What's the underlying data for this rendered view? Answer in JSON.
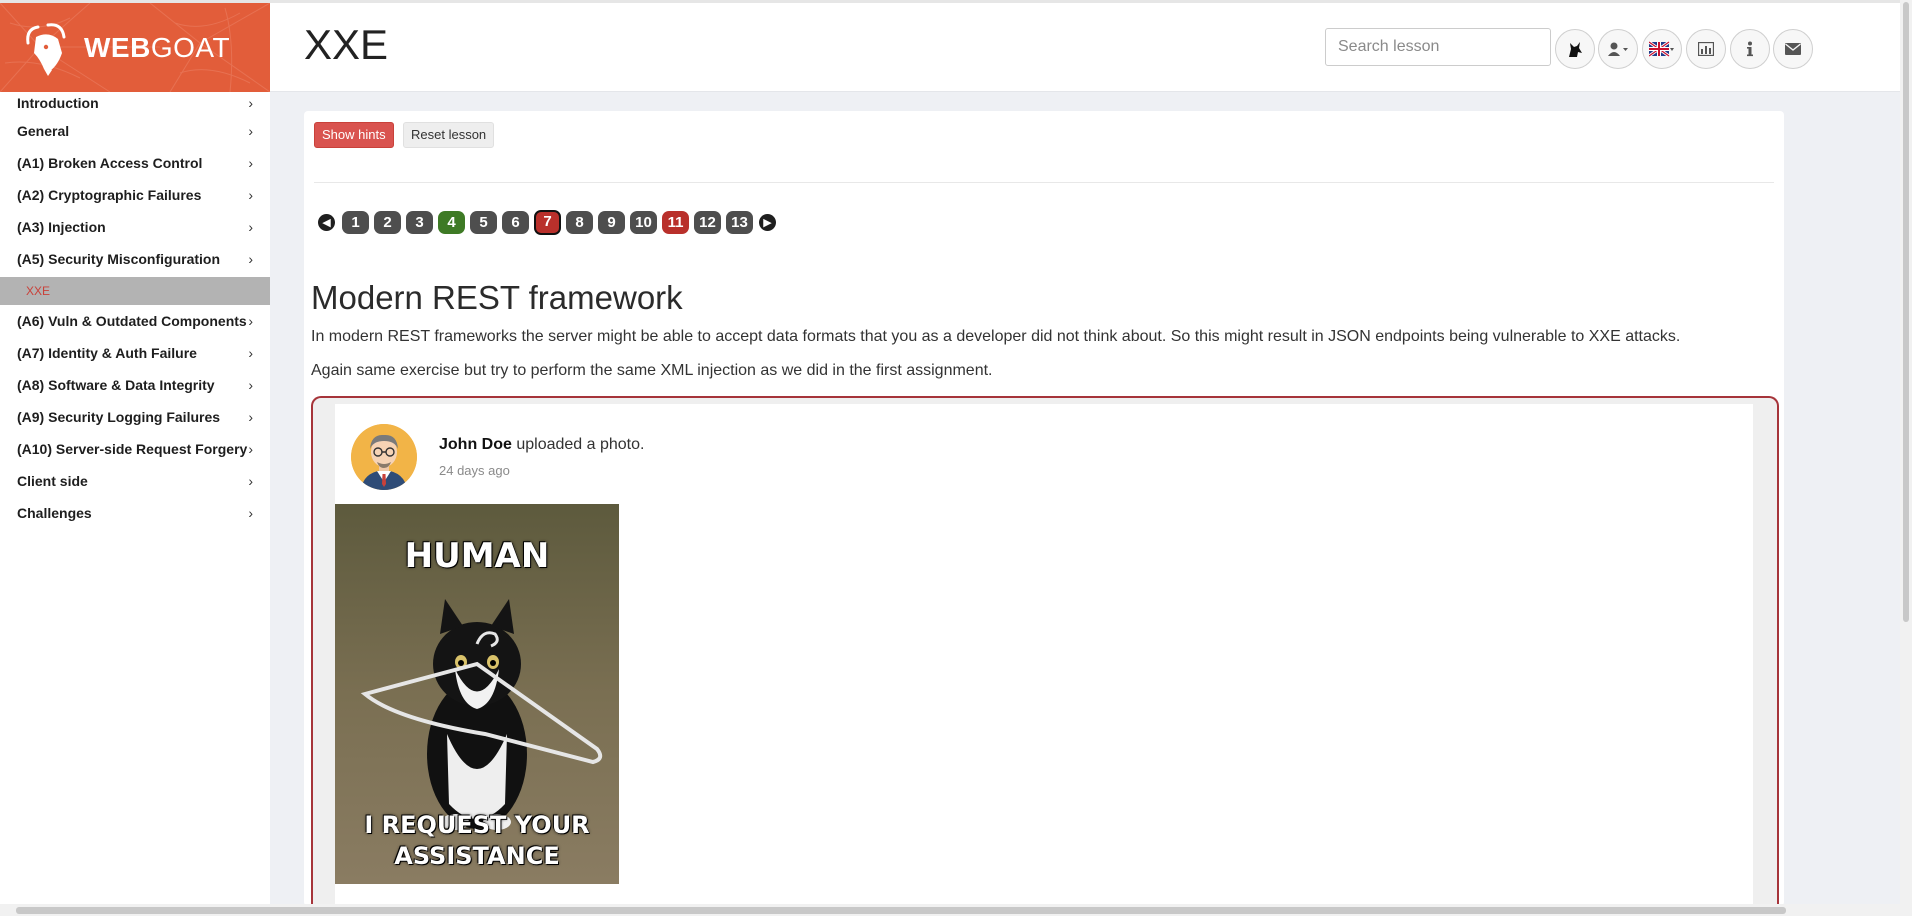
{
  "brand": {
    "bold": "WEB",
    "light": "GOAT"
  },
  "header": {
    "title": "XXE",
    "search_placeholder": "Search lesson",
    "icons": [
      "wolf-icon",
      "user-icon",
      "flag-uk-icon",
      "chart-icon",
      "info-icon",
      "mail-icon"
    ]
  },
  "sidebar": {
    "items": [
      {
        "label": "Introduction"
      },
      {
        "label": "General"
      },
      {
        "label": "(A1) Broken Access Control"
      },
      {
        "label": "(A2) Cryptographic Failures"
      },
      {
        "label": "(A3) Injection"
      },
      {
        "label": "(A5) Security Misconfiguration"
      },
      {
        "label": "(A6) Vuln & Outdated Components"
      },
      {
        "label": "(A7) Identity & Auth Failure"
      },
      {
        "label": "(A8) Software & Data Integrity"
      },
      {
        "label": "(A9) Security Logging Failures"
      },
      {
        "label": "(A10) Server-side Request Forgery"
      },
      {
        "label": "Client side"
      },
      {
        "label": "Challenges"
      }
    ],
    "active_sub": "XXE",
    "chevron": "›"
  },
  "toolbar": {
    "show_hints": "Show hints",
    "reset_lesson": "Reset lesson"
  },
  "pager": {
    "pages": [
      {
        "label": "1",
        "state": "default"
      },
      {
        "label": "2",
        "state": "default"
      },
      {
        "label": "3",
        "state": "default"
      },
      {
        "label": "4",
        "state": "solved"
      },
      {
        "label": "5",
        "state": "default"
      },
      {
        "label": "6",
        "state": "default"
      },
      {
        "label": "7",
        "state": "current"
      },
      {
        "label": "8",
        "state": "default"
      },
      {
        "label": "9",
        "state": "default"
      },
      {
        "label": "10",
        "state": "default"
      },
      {
        "label": "11",
        "state": "failed"
      },
      {
        "label": "12",
        "state": "default"
      },
      {
        "label": "13",
        "state": "default"
      }
    ],
    "prev_icon": "arrow-left-icon",
    "next_icon": "arrow-right-icon"
  },
  "lesson": {
    "heading": "Modern REST framework",
    "p1": "In modern REST frameworks the server might be able to accept data formats that you as a developer did not think about. So this might result in JSON endpoints being vulnerable to XXE attacks.",
    "p2": "Again same exercise but try to perform the same XML injection as we did in the first assignment."
  },
  "post": {
    "author": "John Doe",
    "action": " uploaded a photo.",
    "time": "24 days ago",
    "photo_caption_top": "HUMAN",
    "photo_caption_bottom_1": "I REQUEST YOUR",
    "photo_caption_bottom_2": "ASSISTANCE"
  },
  "colors": {
    "brand": "#e25d3a",
    "hints_button": "#d9534f",
    "solved": "#3e7a25",
    "failed": "#b9302b",
    "assignment_border": "#a6343a"
  }
}
